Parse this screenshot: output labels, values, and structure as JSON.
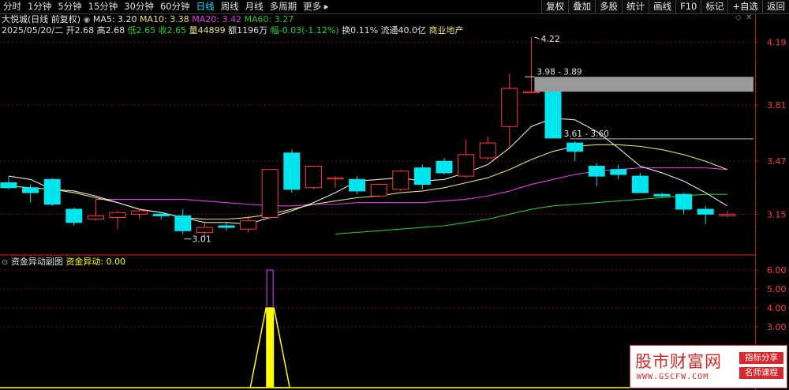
{
  "toolbar": {
    "periods": [
      "分时",
      "1分钟",
      "5分钟",
      "15分钟",
      "30分钟",
      "60分钟",
      "日线",
      "周线",
      "月线",
      "多周期",
      "更多"
    ],
    "active_period": "日线",
    "more_arrow": "▸",
    "buttons": [
      "复权",
      "叠加",
      "多股",
      "统计",
      "画线",
      "F10",
      "标记",
      "+自选",
      "返回"
    ]
  },
  "header": {
    "stock_label": "大悦城(日线 前复权)",
    "ma5": "MA5: 3.20",
    "ma10": "MA10: 3.38",
    "ma20": "MA20: 3.42",
    "ma60": "MA60: 3.27",
    "date": "2025/05/20/二",
    "open_label": "开",
    "open": "2.68",
    "high_label": "高",
    "high": "2.68",
    "low_label": "低",
    "low": "2.65",
    "close_label": "收",
    "close": "2.65",
    "vol_label": "量",
    "vol": "44899",
    "amount_label": "额",
    "amount": "1196万",
    "change_label": "幅",
    "change": "-0.03(-1.12%)",
    "turnover_label": "换",
    "turnover": "0.11%",
    "float_label": "流通",
    "float": "40.0亿",
    "sector": "商业地产"
  },
  "annotations": {
    "high_mark": "4.22",
    "low_mark": "3.01",
    "gap_upper": "3.98 - 3.89",
    "gap_lower": "3.61 - 3.60"
  },
  "sub": {
    "title": "资金异动副图",
    "indicator": "资金异动: 0.00"
  },
  "axis": {
    "main_ticks": [
      "4.19",
      "3.81",
      "3.47",
      "3.15"
    ],
    "sub_ticks": [
      "6.00",
      "5.00",
      "4.00",
      "3.00"
    ]
  },
  "watermark": {
    "title": "股市财富网",
    "url": "WWW.GSCFW.COM",
    "tag1": "指标分享",
    "tag2": "名师课程"
  },
  "colors": {
    "up": "#ff3c3c",
    "down": "#00e5ee",
    "ma5": "#e6e6e6",
    "ma10": "#e8e07a",
    "ma20": "#e040e0",
    "ma60": "#30c030",
    "signal": "#ffff00",
    "spike": "#b030d0"
  },
  "chart_data": {
    "type": "candlestick",
    "series": [
      {
        "o": 3.34,
        "h": 3.38,
        "l": 3.3,
        "c": 3.31
      },
      {
        "o": 3.31,
        "h": 3.33,
        "l": 3.22,
        "c": 3.28
      },
      {
        "o": 3.36,
        "h": 3.37,
        "l": 3.2,
        "c": 3.21
      },
      {
        "o": 3.18,
        "h": 3.19,
        "l": 3.08,
        "c": 3.1
      },
      {
        "o": 3.12,
        "h": 3.24,
        "l": 3.11,
        "c": 3.14
      },
      {
        "o": 3.13,
        "h": 3.17,
        "l": 3.06,
        "c": 3.16
      },
      {
        "o": 3.15,
        "h": 3.18,
        "l": 3.12,
        "c": 3.17
      },
      {
        "o": 3.15,
        "h": 3.16,
        "l": 3.12,
        "c": 3.14
      },
      {
        "o": 3.14,
        "h": 3.18,
        "l": 3.03,
        "c": 3.05
      },
      {
        "o": 3.04,
        "h": 3.1,
        "l": 3.01,
        "c": 3.07
      },
      {
        "o": 3.08,
        "h": 3.1,
        "l": 3.05,
        "c": 3.07
      },
      {
        "o": 3.06,
        "h": 3.14,
        "l": 3.04,
        "c": 3.11
      },
      {
        "o": 3.13,
        "h": 3.42,
        "l": 3.12,
        "c": 3.42
      },
      {
        "o": 3.52,
        "h": 3.54,
        "l": 3.28,
        "c": 3.3
      },
      {
        "o": 3.31,
        "h": 3.44,
        "l": 3.3,
        "c": 3.44
      },
      {
        "o": 3.37,
        "h": 3.38,
        "l": 3.31,
        "c": 3.37
      },
      {
        "o": 3.36,
        "h": 3.38,
        "l": 3.27,
        "c": 3.29
      },
      {
        "o": 3.26,
        "h": 3.32,
        "l": 3.25,
        "c": 3.33
      },
      {
        "o": 3.3,
        "h": 3.42,
        "l": 3.29,
        "c": 3.41
      },
      {
        "o": 3.43,
        "h": 3.45,
        "l": 3.3,
        "c": 3.33
      },
      {
        "o": 3.47,
        "h": 3.49,
        "l": 3.39,
        "c": 3.4
      },
      {
        "o": 3.38,
        "h": 3.6,
        "l": 3.37,
        "c": 3.51
      },
      {
        "o": 3.49,
        "h": 3.62,
        "l": 3.48,
        "c": 3.58
      },
      {
        "o": 3.68,
        "h": 4.0,
        "l": 3.55,
        "c": 3.91
      },
      {
        "o": 3.89,
        "h": 4.22,
        "l": 3.89,
        "c": 3.89
      },
      {
        "o": 3.89,
        "h": 3.9,
        "l": 3.61,
        "c": 3.61
      },
      {
        "o": 3.58,
        "h": 3.59,
        "l": 3.47,
        "c": 3.53
      },
      {
        "o": 3.44,
        "h": 3.46,
        "l": 3.32,
        "c": 3.38
      },
      {
        "o": 3.42,
        "h": 3.45,
        "l": 3.36,
        "c": 3.39
      },
      {
        "o": 3.38,
        "h": 3.4,
        "l": 3.28,
        "c": 3.28
      },
      {
        "o": 3.27,
        "h": 3.28,
        "l": 3.25,
        "c": 3.26
      },
      {
        "o": 3.27,
        "h": 3.28,
        "l": 3.15,
        "c": 3.18
      },
      {
        "o": 3.18,
        "h": 3.2,
        "l": 3.09,
        "c": 3.15
      },
      {
        "o": 3.14,
        "h": 3.17,
        "l": 3.13,
        "c": 3.15
      }
    ],
    "ma5": [
      3.38,
      3.36,
      3.3,
      3.29,
      3.26,
      3.22,
      3.18,
      3.16,
      3.13,
      3.1,
      3.1,
      3.09,
      3.13,
      3.17,
      3.22,
      3.28,
      3.35,
      3.36,
      3.37,
      3.35,
      3.36,
      3.4,
      3.45,
      3.55,
      3.68,
      3.73,
      3.72,
      3.65,
      3.55,
      3.44,
      3.4,
      3.35,
      3.28,
      3.2
    ],
    "ma10": [
      3.32,
      3.31,
      3.3,
      3.28,
      3.25,
      3.22,
      3.18,
      3.16,
      3.13,
      3.12,
      3.12,
      3.13,
      3.15,
      3.18,
      3.21,
      3.23,
      3.25,
      3.26,
      3.28,
      3.29,
      3.31,
      3.34,
      3.37,
      3.42,
      3.48,
      3.53,
      3.56,
      3.57,
      3.57,
      3.56,
      3.54,
      3.51,
      3.47,
      3.42
    ],
    "ma20": [
      null,
      null,
      null,
      null,
      3.24,
      3.24,
      3.24,
      3.24,
      3.24,
      3.23,
      3.22,
      3.21,
      3.2,
      3.2,
      3.21,
      3.21,
      3.22,
      3.22,
      3.22,
      3.22,
      3.23,
      3.24,
      3.26,
      3.29,
      3.33,
      3.36,
      3.39,
      3.41,
      3.42,
      3.43,
      3.43,
      3.43,
      3.43,
      3.42
    ],
    "ma60": [
      null,
      null,
      null,
      null,
      null,
      null,
      null,
      null,
      null,
      null,
      null,
      null,
      null,
      null,
      null,
      3.03,
      3.04,
      3.05,
      3.06,
      3.07,
      3.08,
      3.1,
      3.12,
      3.15,
      3.18,
      3.2,
      3.21,
      3.22,
      3.23,
      3.24,
      3.25,
      3.26,
      3.27,
      3.27
    ],
    "signal": {
      "index": 12,
      "value": 4.0,
      "peak": 6.0
    }
  }
}
